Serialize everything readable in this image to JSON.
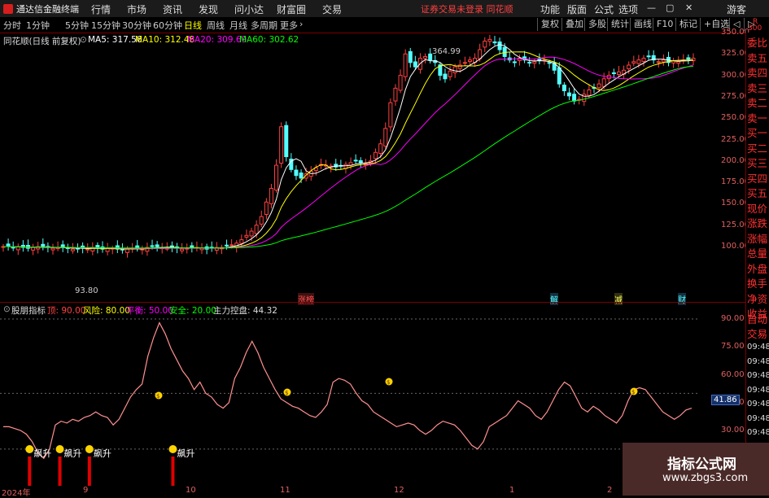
{
  "app": {
    "title": "通达信金融终端"
  },
  "menu": [
    "行情",
    "市场",
    "资讯",
    "发现",
    "问小达",
    "财富圈",
    "交易"
  ],
  "notice": "证券交易未登录 同花顺",
  "right_menu": [
    "功能",
    "版面",
    "公式",
    "选项"
  ],
  "guest": "游客",
  "window_ctrl": {
    "min": "—",
    "max": "▢",
    "close": "✕"
  },
  "periods": [
    "分时",
    "1分钟",
    "5分钟",
    "15分钟",
    "30分钟",
    "60分钟",
    "日线",
    "周线",
    "月线",
    "多周期",
    "更多"
  ],
  "active_period": "日线",
  "toolbar": [
    "复权",
    "叠加",
    "多股",
    "统计",
    "画线",
    "F10",
    "标记",
    "+自选",
    "◁",
    "▷"
  ],
  "stock_header": "同花顺(日线 前复权)",
  "ma": {
    "ma5": "MA5: 317.56",
    "ma10": "MA10: 312.48",
    "ma20": "MA20: 309.69",
    "ma60": "MA60: 302.62"
  },
  "peak_label": "364.99",
  "low_label": "93.80",
  "event_tags": [
    "涨榜",
    "解",
    "减",
    "财"
  ],
  "y_main": [
    "350.00",
    "325.00",
    "300.00",
    "275.00",
    "250.00",
    "225.00",
    "200.00",
    "175.00",
    "150.00",
    "125.00",
    "100.00"
  ],
  "sub": {
    "name": "股朋指标",
    "top": "顶: 90.00",
    "risk": "风险: 80.00",
    "balance": "平衡: 50.00",
    "safe": "安全: 20.00",
    "main": "主力控盘: 44.32"
  },
  "y_sub": [
    "90.00",
    "75.00",
    "60.00",
    "45.00",
    "30.00"
  ],
  "current_value": "41.86",
  "signal_text": "飙升",
  "x_labels": [
    "2024年",
    "9",
    "10",
    "11",
    "12",
    "1",
    "2"
  ],
  "right_panel": [
    "R",
    "300",
    "委比",
    "卖五",
    "卖四",
    "卖三",
    "卖二",
    "卖一",
    "买一",
    "买二",
    "买三",
    "买四",
    "买五",
    "现价",
    "涨跌",
    "涨幅",
    "总量",
    "外盘",
    "换手",
    "净资",
    "收益",
    "自动",
    "交易"
  ],
  "time_col": [
    "09:48",
    "09:48",
    "09:48",
    "09:48",
    "09:48",
    "09:48",
    "09:48",
    "09:48"
  ],
  "watermark": {
    "line1": "指标公式网",
    "line2": "www.zbgs3.com"
  },
  "colors": {
    "ma5": "#ffffff",
    "ma10": "#ffff00",
    "ma20": "#ff00ff",
    "ma60": "#00ff00",
    "up": "#ff4040",
    "down": "#54ffff",
    "indicator": "#ff9090"
  },
  "chart_data": {
    "type": "candlestick",
    "ylim": [
      90,
      370
    ],
    "closes": [
      100,
      100,
      99,
      100,
      99,
      98,
      99,
      100,
      99,
      99,
      98,
      99,
      99,
      98,
      97,
      98,
      98,
      97,
      99,
      98,
      97,
      98,
      98,
      97,
      96,
      97,
      98,
      98,
      97,
      99,
      100,
      100,
      99,
      98,
      99,
      98,
      97,
      98,
      99,
      99,
      98,
      97,
      98,
      99,
      99,
      101,
      102,
      104,
      108,
      113,
      118,
      125,
      135,
      152,
      168,
      195,
      240,
      205,
      190,
      183,
      180,
      185,
      188,
      192,
      196,
      195,
      194,
      193,
      194,
      196,
      198,
      200,
      198,
      197,
      200,
      210,
      220,
      238,
      268,
      285,
      300,
      325,
      315,
      310,
      320,
      322,
      318,
      315,
      300,
      296,
      305,
      310,
      312,
      315,
      318,
      320,
      330,
      340,
      342,
      338,
      330,
      322,
      318,
      315,
      320,
      318,
      315,
      316,
      317,
      318,
      314,
      306,
      290,
      282,
      276,
      270,
      272,
      278,
      283,
      285,
      290,
      296,
      300,
      302,
      304,
      306,
      312,
      316,
      318,
      320,
      322,
      318,
      316,
      318,
      315,
      317,
      316,
      318,
      319,
      320
    ],
    "indicator": [
      32,
      32,
      31,
      30,
      28,
      24,
      18,
      15,
      20,
      33,
      35,
      34,
      36,
      35,
      37,
      38,
      40,
      38,
      37,
      33,
      36,
      42,
      48,
      52,
      55,
      70,
      80,
      88,
      82,
      74,
      68,
      62,
      58,
      52,
      56,
      50,
      48,
      44,
      42,
      45,
      58,
      64,
      72,
      78,
      72,
      64,
      58,
      52,
      47,
      45,
      43,
      42,
      40,
      38,
      37,
      40,
      44,
      56,
      58,
      57,
      55,
      50,
      46,
      44,
      40,
      38,
      36,
      34,
      32,
      33,
      34,
      33,
      30,
      28,
      30,
      33,
      35,
      34,
      33,
      30,
      26,
      22,
      20,
      24,
      32,
      34,
      36,
      38,
      42,
      46,
      44,
      42,
      38,
      36,
      40,
      46,
      52,
      56,
      54,
      48,
      42,
      40,
      43,
      41,
      38,
      36,
      34,
      38,
      46,
      52,
      53,
      52,
      48,
      44,
      40,
      38,
      36,
      38,
      41,
      42
    ],
    "signals": [
      40,
      81,
      121,
      234
    ]
  }
}
